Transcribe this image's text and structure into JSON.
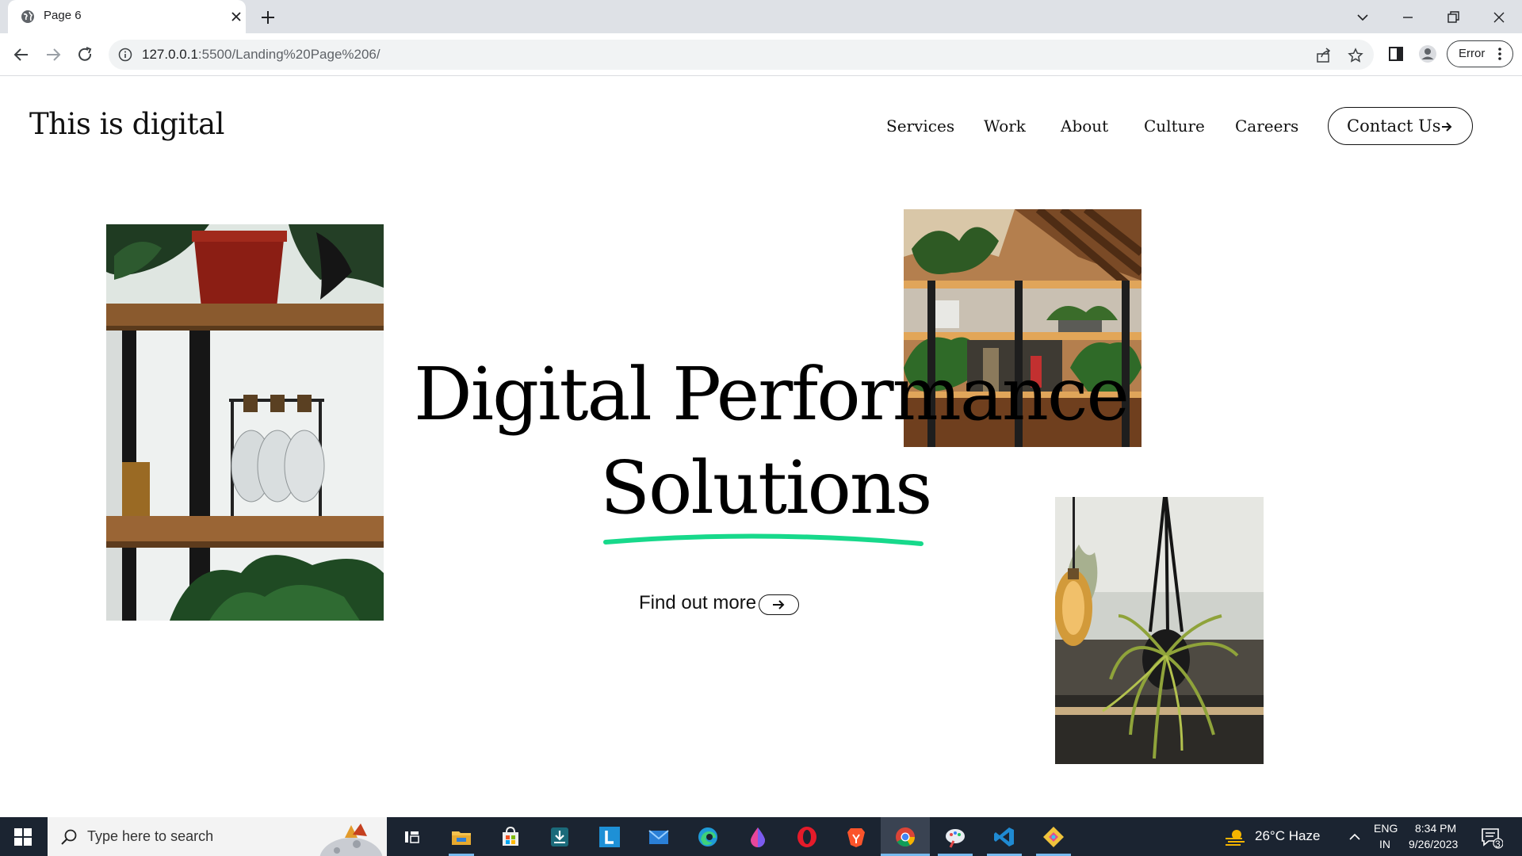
{
  "browser": {
    "tab_title": "Page 6",
    "url_host": "127.0.0.1",
    "url_rest": ":5500/Landing%20Page%206/",
    "profile_button": "Error"
  },
  "site": {
    "brand": "This is digital",
    "nav": [
      "Services",
      "Work",
      "About",
      "Culture",
      "Careers"
    ],
    "contact_label": "Contact Us",
    "headline_line1": "Digital Performance",
    "headline_line2": "Solutions",
    "cta_label": "Find out more",
    "accent_color": "#17d98b"
  },
  "taskbar": {
    "search_placeholder": "Type here to search",
    "weather": "26°C  Haze",
    "lang_1": "ENG",
    "lang_2": "IN",
    "time": "8:34 PM",
    "date": "9/26/2023",
    "notification_count": "3"
  }
}
